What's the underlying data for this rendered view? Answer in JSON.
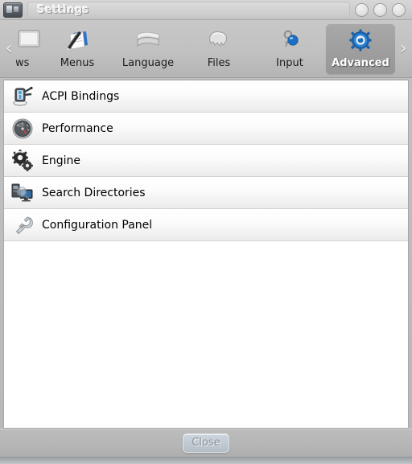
{
  "window": {
    "title": "Settings",
    "icon": "settings-window-icon",
    "buttons": [
      {
        "name": "minimize-button",
        "label": ""
      },
      {
        "name": "maximize-button",
        "label": ""
      },
      {
        "name": "close-window-button",
        "label": ""
      }
    ]
  },
  "toolbar": {
    "scroll_left": "‹",
    "scroll_right": "›",
    "tabs": [
      {
        "label": "ws",
        "icon": "windows-icon",
        "selected": false,
        "clipped": true
      },
      {
        "label": "Menus",
        "icon": "menus-pen-document-icon",
        "selected": false,
        "clipped": false
      },
      {
        "label": "Language",
        "icon": "language-book-icon",
        "selected": false,
        "clipped": false
      },
      {
        "label": "Files",
        "icon": "files-folder-icon",
        "selected": false,
        "clipped": false
      },
      {
        "label": "Input",
        "icon": "input-key-ball-icon",
        "selected": false,
        "clipped": false
      },
      {
        "label": "Advanced",
        "icon": "advanced-gear-icon",
        "selected": true,
        "clipped": false
      }
    ]
  },
  "list": {
    "items": [
      {
        "label": "ACPI Bindings",
        "icon": "acpi-power-plug-icon"
      },
      {
        "label": "Performance",
        "icon": "performance-gauge-icon"
      },
      {
        "label": "Engine",
        "icon": "engine-gears-icon"
      },
      {
        "label": "Search Directories",
        "icon": "search-directories-icon"
      },
      {
        "label": "Configuration Panel",
        "icon": "configuration-wrench-icon"
      }
    ]
  },
  "footer": {
    "close_label": "Close"
  },
  "colors": {
    "accent_blue": "#1c72c4",
    "window_chrome": "#c0c0c0",
    "selected_tab": "#a0a0a0",
    "list_background": "#ffffff"
  }
}
